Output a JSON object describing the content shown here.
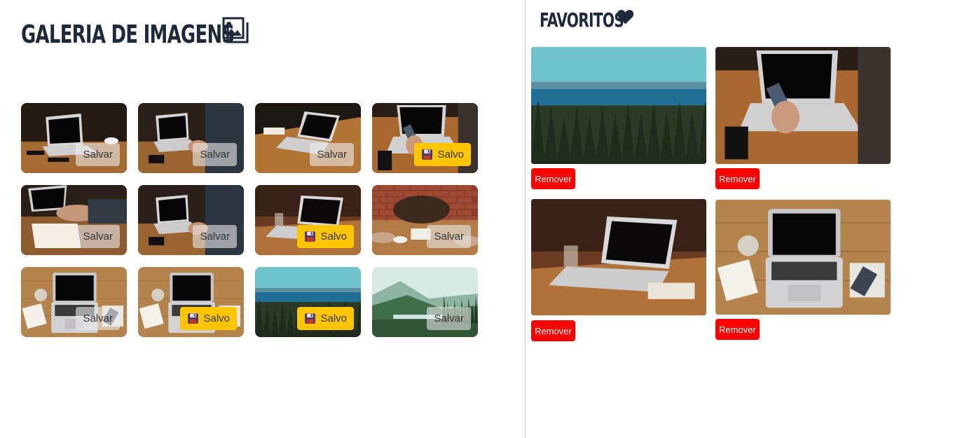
{
  "gallery": {
    "title": "GALERIA DE IMAGENS",
    "title_icon": "image-icon",
    "images": [
      {
        "scene": "laptop-desk",
        "button_label": "Salvar",
        "saved": false
      },
      {
        "scene": "typing-laptop",
        "button_label": "Salvar",
        "saved": false
      },
      {
        "scene": "laptop-table",
        "button_label": "Salvar",
        "saved": false
      },
      {
        "scene": "phone-laptop",
        "button_label": "Salvo",
        "saved": true
      },
      {
        "scene": "notebook-writing",
        "button_label": "Salvar",
        "saved": false
      },
      {
        "scene": "typing-laptop",
        "button_label": "Salvar",
        "saved": false
      },
      {
        "scene": "laptop-glass",
        "button_label": "Salvo",
        "saved": true
      },
      {
        "scene": "meeting-brick",
        "button_label": "Salvar",
        "saved": false
      },
      {
        "scene": "laptop-topdown",
        "button_label": "Salvar",
        "saved": false
      },
      {
        "scene": "laptop-topdown",
        "button_label": "Salvo",
        "saved": true
      },
      {
        "scene": "forest-sea",
        "button_label": "Salvo",
        "saved": true
      },
      {
        "scene": "valley-mist",
        "button_label": "Salvar",
        "saved": false
      }
    ]
  },
  "favorites": {
    "title": "FAVORITOS",
    "title_icon": "heart-icon",
    "items": [
      {
        "scene": "forest-sea",
        "button_label": "Remover"
      },
      {
        "scene": "phone-laptop",
        "button_label": "Remover"
      },
      {
        "scene": "laptop-glass",
        "button_label": "Remover"
      },
      {
        "scene": "laptop-topdown",
        "button_label": "Remover"
      }
    ]
  },
  "colors": {
    "title": "#1e2a3b",
    "saved_button": "#ffc600",
    "unsaved_button": "rgba(235,235,235,0.6)",
    "remove_button": "#ff0000",
    "divider": "#c8c8c8"
  }
}
